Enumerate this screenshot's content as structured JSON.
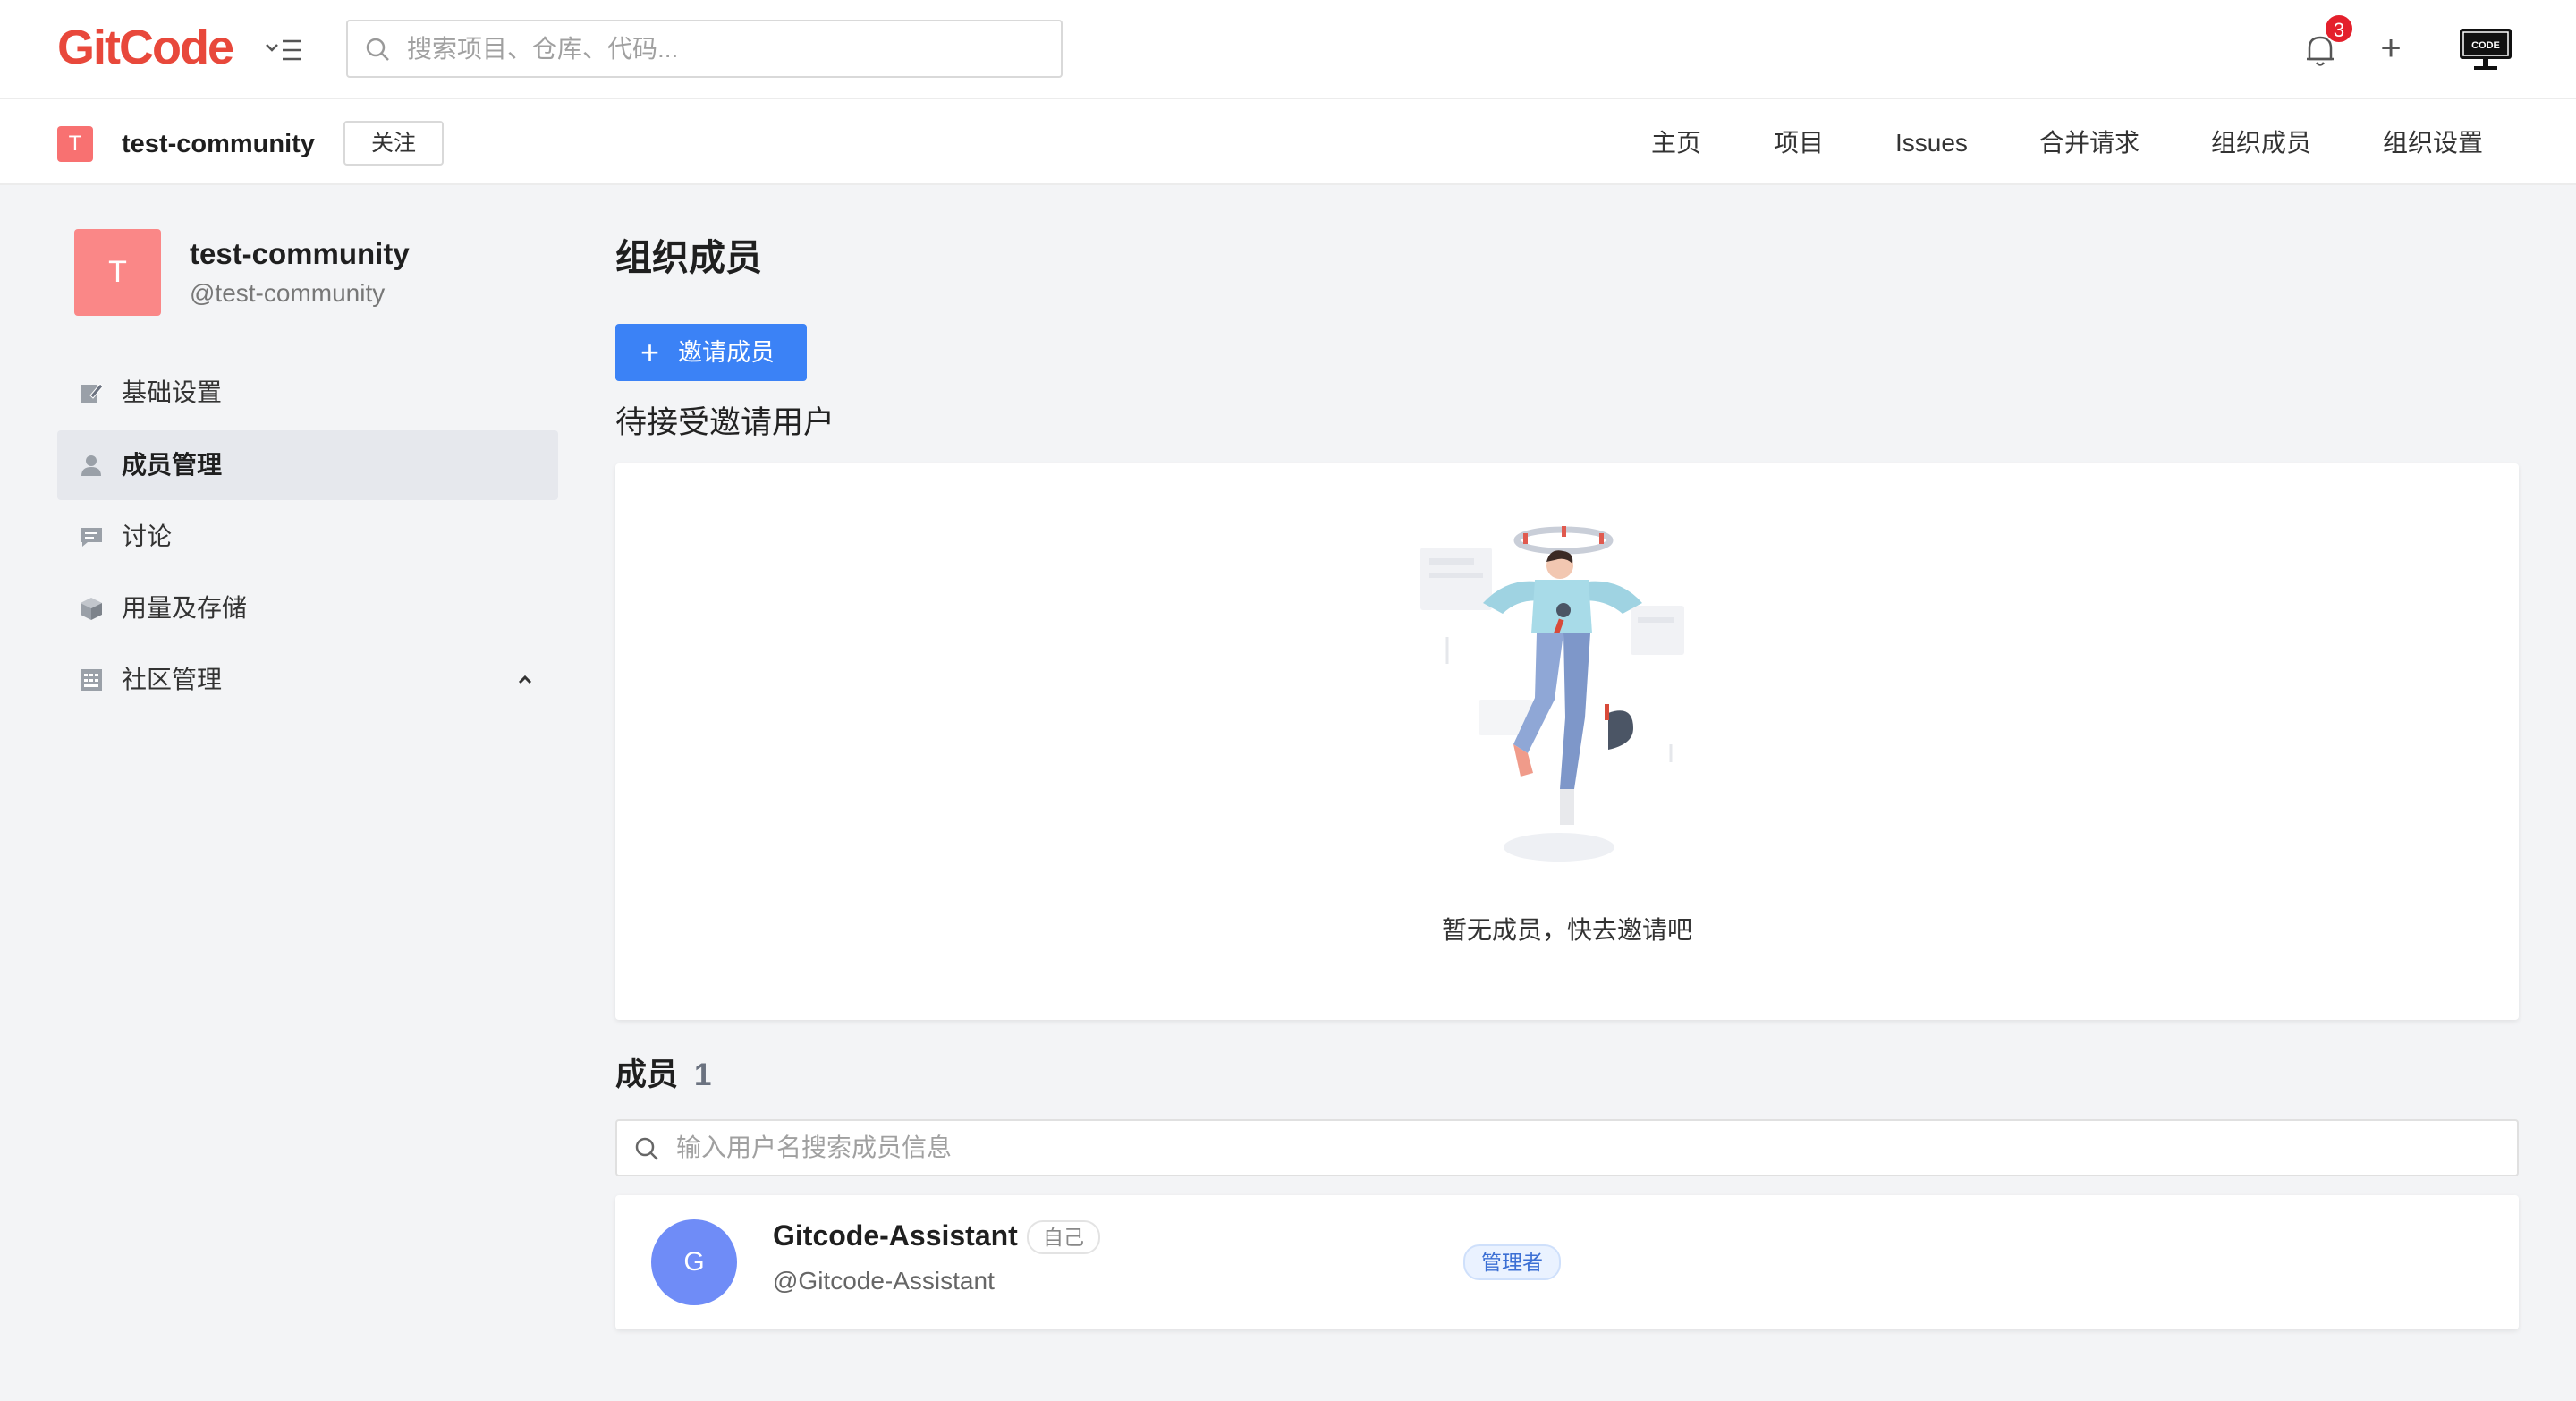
{
  "header": {
    "logo_text": "GitCode",
    "search_placeholder": "搜索项目、仓库、代码...",
    "notification_count": "3",
    "plus_label": "+",
    "code_icon_label": "CODE"
  },
  "org_bar": {
    "avatar_letter": "T",
    "org_name": "test-community",
    "follow_label": "关注",
    "nav": [
      "主页",
      "项目",
      "Issues",
      "合并请求",
      "组织成员",
      "组织设置"
    ]
  },
  "sidebar": {
    "avatar_letter": "T",
    "org_title": "test-community",
    "org_handle": "@test-community",
    "items": [
      {
        "label": "基础设置",
        "icon": "edit-icon"
      },
      {
        "label": "成员管理",
        "icon": "user-icon",
        "active": true
      },
      {
        "label": "讨论",
        "icon": "chat-icon"
      },
      {
        "label": "用量及存储",
        "icon": "box-icon"
      },
      {
        "label": "社区管理",
        "icon": "grid-icon",
        "expanded": true
      }
    ]
  },
  "main": {
    "title": "组织成员",
    "invite_button": "邀请成员",
    "invite_plus": "+",
    "pending_title": "待接受邀请用户",
    "empty_text": "暂无成员，快去邀请吧",
    "members_title": "成员",
    "members_count": "1",
    "member_search_placeholder": "输入用户名搜索成员信息",
    "members": [
      {
        "avatar_letter": "G",
        "name": "Gitcode-Assistant",
        "self_tag": "自己",
        "handle": "@Gitcode-Assistant",
        "role": "管理者"
      }
    ]
  },
  "colors": {
    "brand": "#e8483b",
    "primary": "#3b82f6",
    "badge": "#e4202c",
    "org_avatar": "#fa8787",
    "member_avatar": "#6f8cf7"
  }
}
